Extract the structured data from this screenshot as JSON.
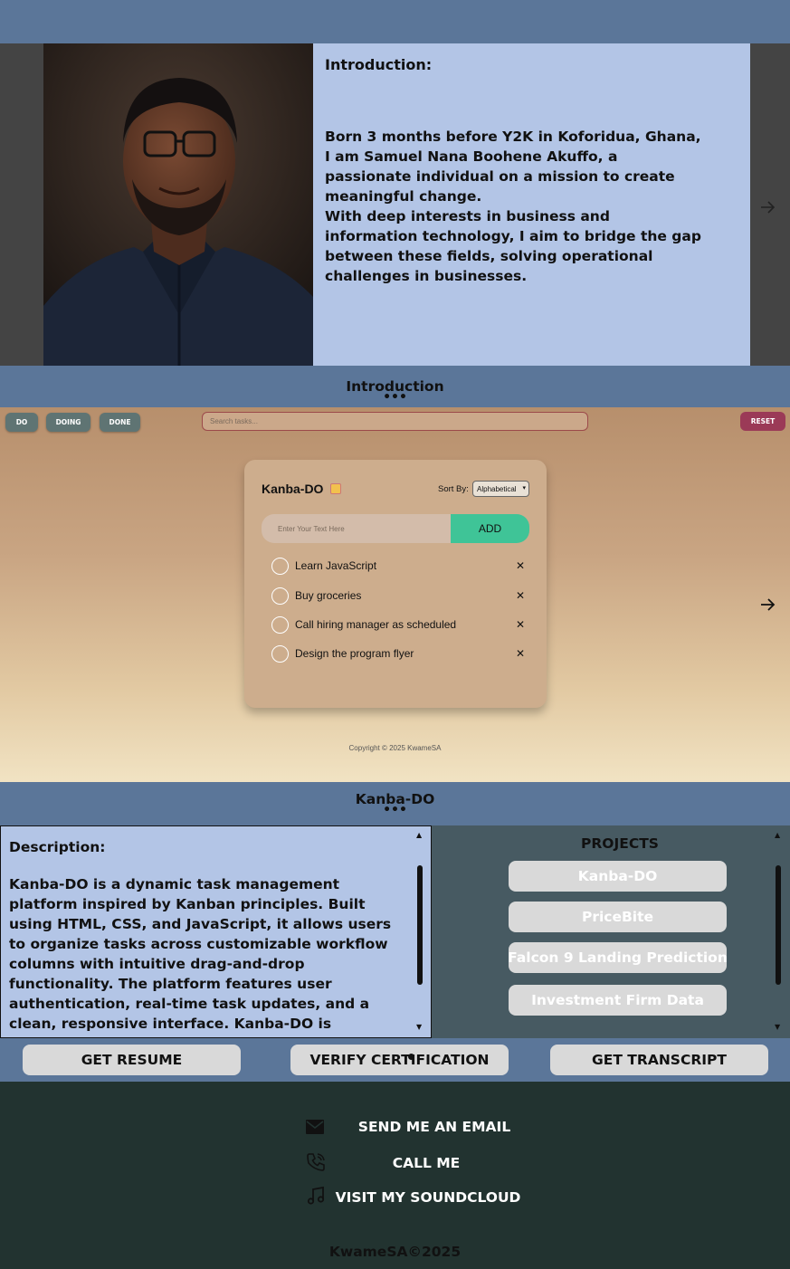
{
  "intro": {
    "heading": "Introduction:",
    "paragraphs": [
      "Born 3 months before Y2K in Koforidua, Ghana, I am Samuel Nana Boohene Akuffo, a passionate individual on a mission to create meaningful change.",
      "With deep interests in business and information technology, I aim to bridge the gap between these fields, solving operational challenges in businesses."
    ],
    "caption": "Introduction",
    "dots": "•••"
  },
  "kanba": {
    "tabs": [
      "DO",
      "DOING",
      "DONE"
    ],
    "search_placeholder": "Search tasks...",
    "reset_label": "RESET",
    "title": "Kanba-DO",
    "sort_label": "Sort By:",
    "sort_value": "Alphabetical",
    "input_placeholder": "Enter Your Text Here",
    "add_label": "ADD",
    "tasks": [
      "Learn JavaScript",
      "Buy groceries",
      "Call hiring manager as scheduled",
      "Design the program flyer"
    ],
    "remove_glyph": "✕",
    "copyright": "Copyright © 2025 KwameSA",
    "caption": "Kanba-DO",
    "dots": "•••"
  },
  "description": {
    "heading": "Description:",
    "body": "Kanba-DO is a dynamic task management platform inspired by Kanban principles. Built using HTML, CSS, and JavaScript, it allows users to organize tasks across customizable workflow columns with intuitive drag-and-drop functionality. The platform features user authentication, real-time task updates, and a clean, responsive interface. Kanba-DO is designed to boost productivity by offering a visual overview of"
  },
  "projects": {
    "heading": "PROJECTS",
    "items": [
      "Kanba-DO",
      "PriceBite",
      "Falcon 9 Landing Prediction",
      "Investment Firm Data"
    ]
  },
  "actions": {
    "resume": "GET RESUME",
    "verify": "VERIFY CERTIFICATION",
    "transcript": "GET TRANSCRIPT"
  },
  "contact": {
    "email_label": "SEND ME AN EMAIL",
    "call_label": "CALL ME",
    "soundcloud_label": "VISIT MY SOUNDCLOUD"
  },
  "footer": {
    "copyright": "KwameSA©2025"
  },
  "icons": {
    "next_slide": "arrow-right-icon",
    "email": "envelope-icon",
    "phone": "phone-icon",
    "music": "music-note-icon"
  },
  "colors": {
    "header_bg": "#5b7699",
    "intro_panel_bg": "#b3c5e6",
    "projects_bg": "#475a62",
    "footer_bg": "#223330",
    "add_button": "#3fc497",
    "reset_button": "#9b3a57"
  }
}
